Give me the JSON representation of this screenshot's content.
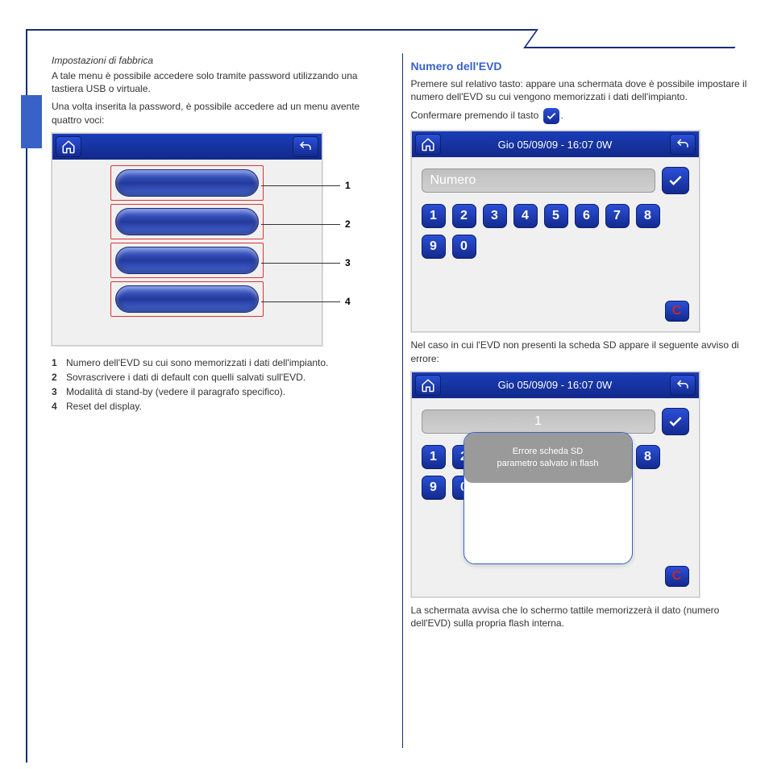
{
  "page": {
    "sub_italic": "Impostazioni di fabbrica",
    "left_intro": "A tale menu è possibile accedere solo tramite password utilizzando una tastiera USB o virtuale.",
    "left_menu_intro": "Una volta inserita la password, è possibile accedere ad un menu avente quattro voci:"
  },
  "screen1": {
    "callouts": [
      "1",
      "2",
      "3",
      "4"
    ]
  },
  "legend": [
    {
      "n": "1",
      "text": "Numero dell'EVD su cui sono memorizzati i dati dell'impianto."
    },
    {
      "n": "2",
      "text": "Sovrascrivere i dati di default con quelli salvati sull'EVD."
    },
    {
      "n": "3",
      "text": "Modalità di stand-by (vedere il paragrafo specifico)."
    },
    {
      "n": "4",
      "text": "Reset del display."
    }
  ],
  "right": {
    "section": "Numero dell'EVD",
    "p1": "Premere sul relativo tasto: appare una schermata dove è possibile impostare il numero dell'EVD su cui vengono memorizzati i dati dell'impianto.",
    "p2_pre": "Confermare premendo il tasto ",
    "p2_post": ".",
    "header_text": "Gio 05/09/09 - 16:07   0W",
    "placeholder": "Numero",
    "keys": [
      "1",
      "2",
      "3",
      "4",
      "5",
      "6",
      "7",
      "8",
      "9",
      "0"
    ],
    "cancel": "C",
    "p3": "Nel caso in cui l'EVD non presenti la scheda SD appare il seguente avviso di errore:",
    "field_value": "1",
    "popup_line1": "Errore scheda SD",
    "popup_line2": "parametro salvato in flash",
    "p4": "La schermata avvisa che lo schermo tattile memorizzerà il dato (numero dell'EVD) sulla propria flash interna."
  }
}
